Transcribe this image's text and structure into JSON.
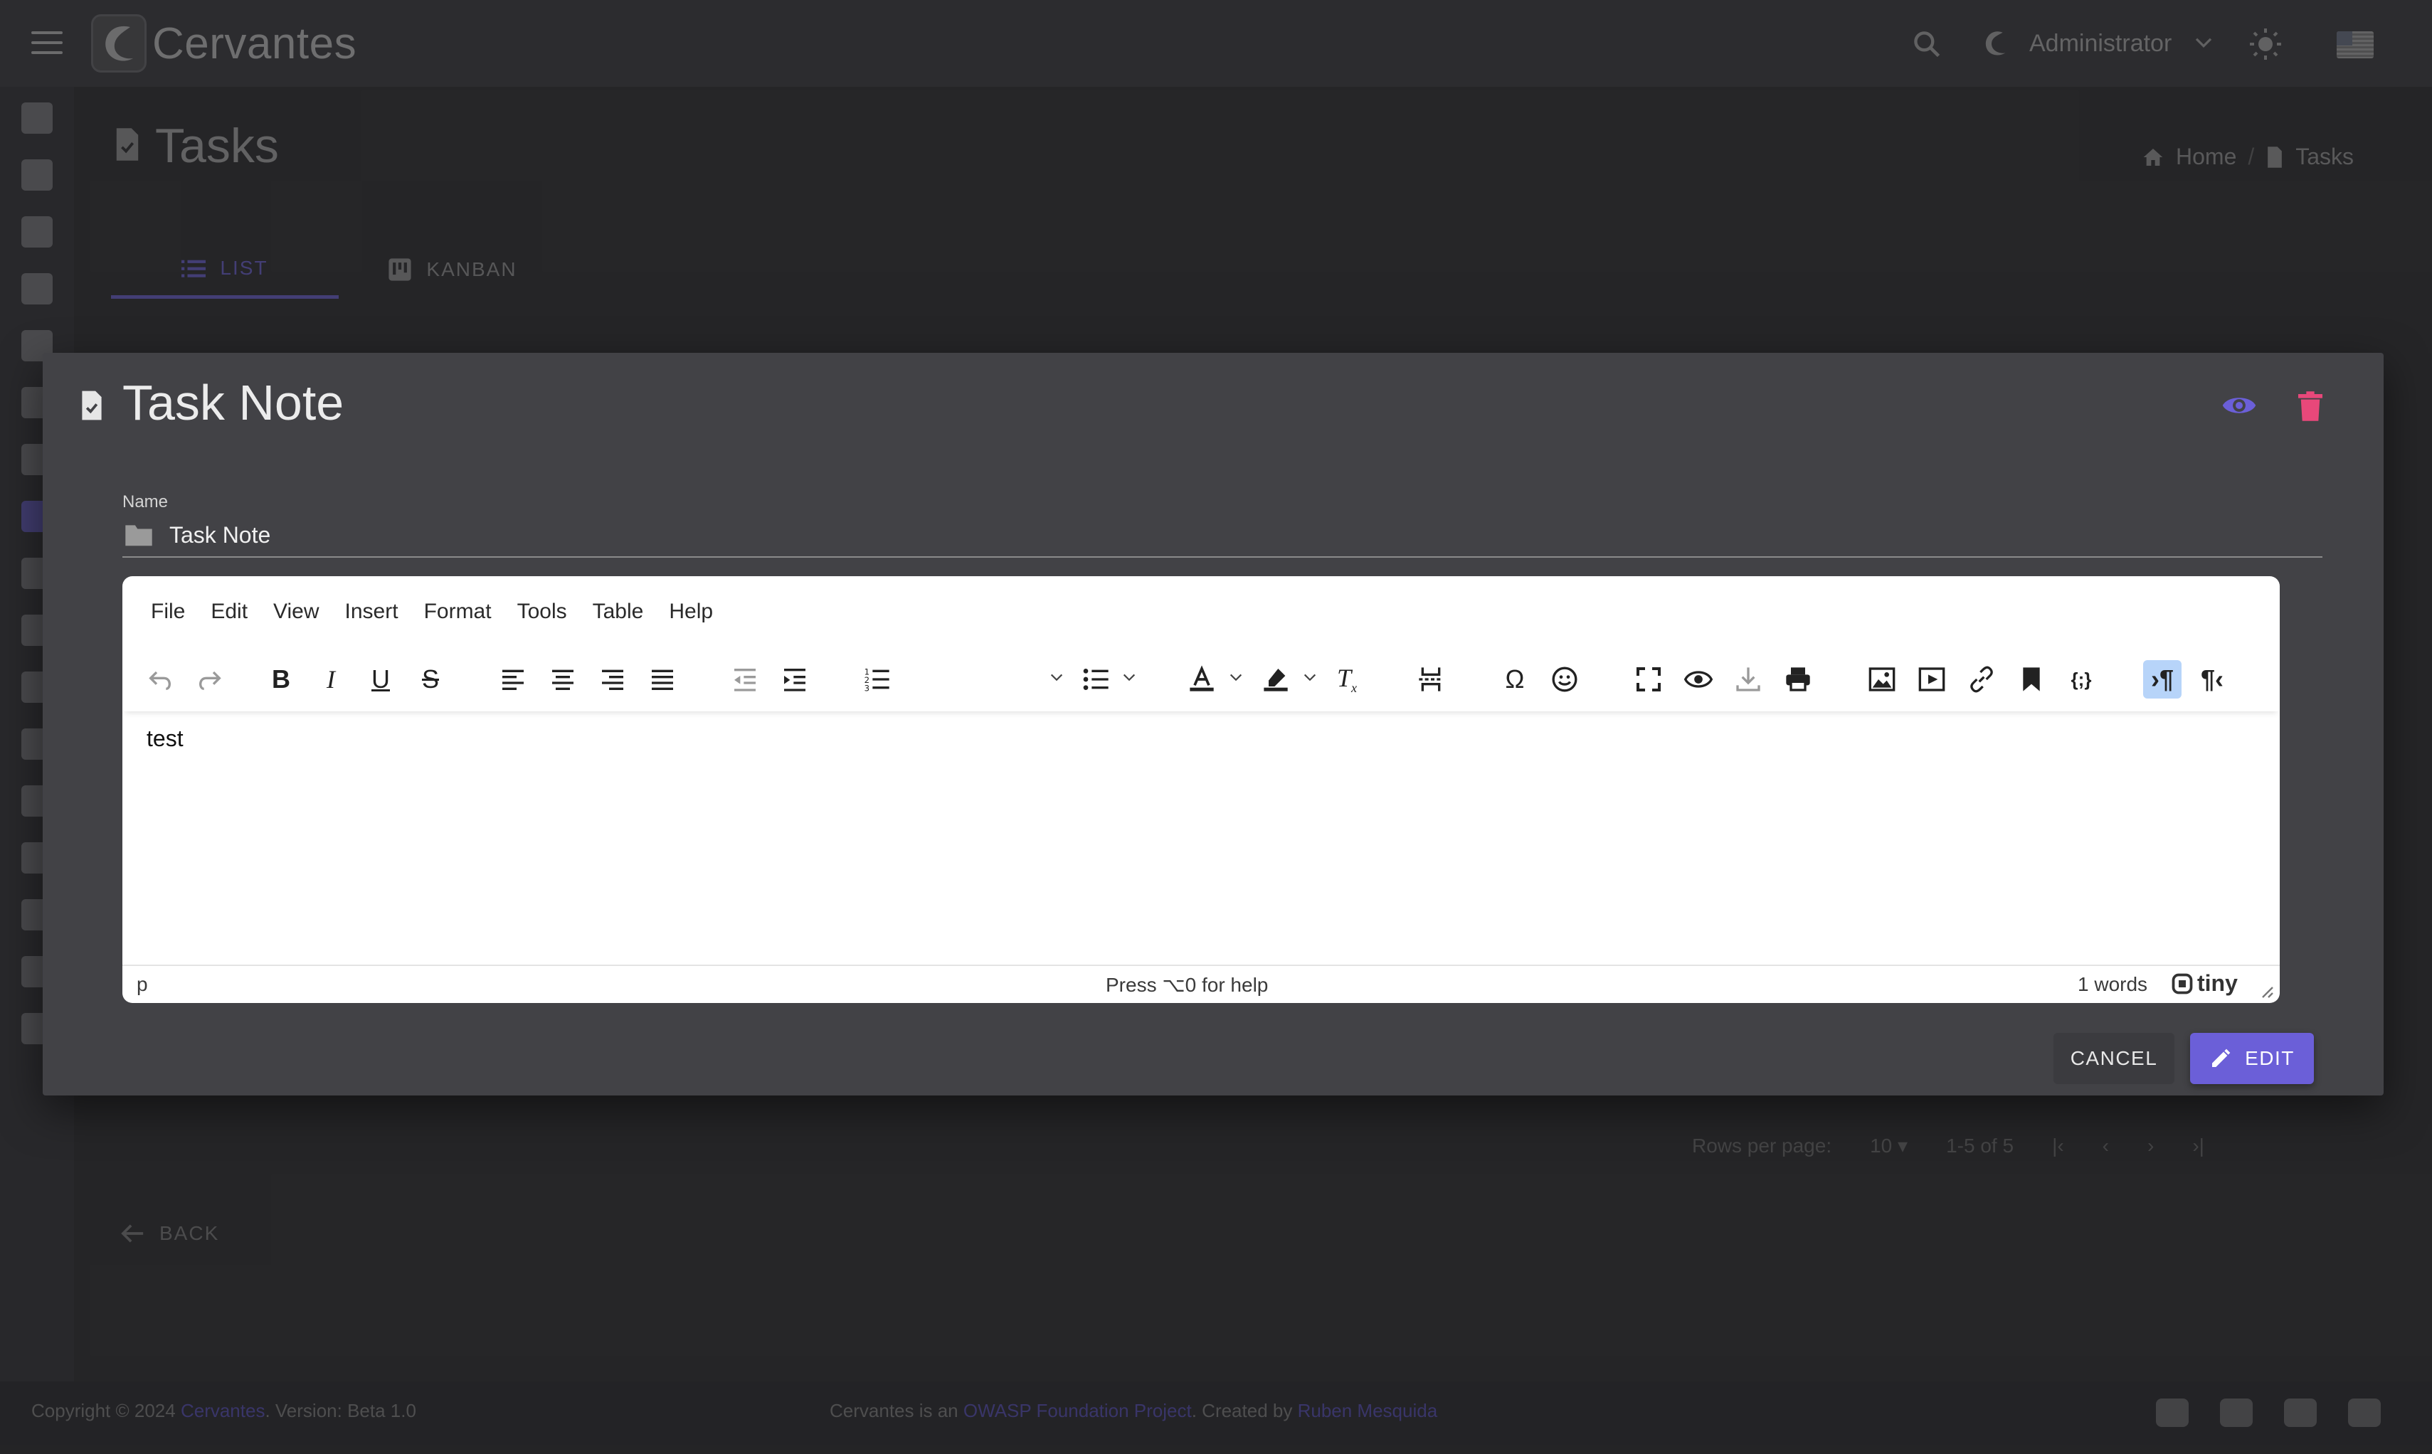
{
  "app": {
    "brand": "Cervantes",
    "user": "Administrator"
  },
  "page": {
    "title": "Tasks"
  },
  "breadcrumbs": [
    {
      "label": "Home"
    },
    {
      "label": "Tasks"
    }
  ],
  "tabs": [
    {
      "label": "LIST",
      "active": true
    },
    {
      "label": "KANBAN",
      "active": false
    }
  ],
  "background": {
    "rows_per_page_label": "Rows per page:",
    "rows_per_page_value": "10",
    "range": "1-5 of 5",
    "back_label": "BACK"
  },
  "footer": {
    "copyright_prefix": "Copyright © 2024",
    "brand_link": "Cervantes",
    "version_label": ". Version:",
    "version": "Beta 1.0",
    "owasp_prefix": "Cervantes is an",
    "owasp_link": "OWASP Foundation Project",
    "created_by": ". Created by",
    "author_link": "Ruben Mesquida"
  },
  "dialog": {
    "title": "Task Note",
    "name_label": "Name",
    "name_value": "Task Note",
    "editor": {
      "menu": [
        "File",
        "Edit",
        "View",
        "Insert",
        "Format",
        "Tools",
        "Table",
        "Help"
      ],
      "content": "test",
      "status_path": "p",
      "status_help": "Press ⌥0 for help",
      "word_count": "1 words",
      "branding": "tiny"
    },
    "cancel_label": "CANCEL",
    "edit_label": "EDIT"
  },
  "colors": {
    "accent": "#6b5fd8",
    "danger": "#e8487a",
    "toolbar_active": "#b7d4f9"
  }
}
